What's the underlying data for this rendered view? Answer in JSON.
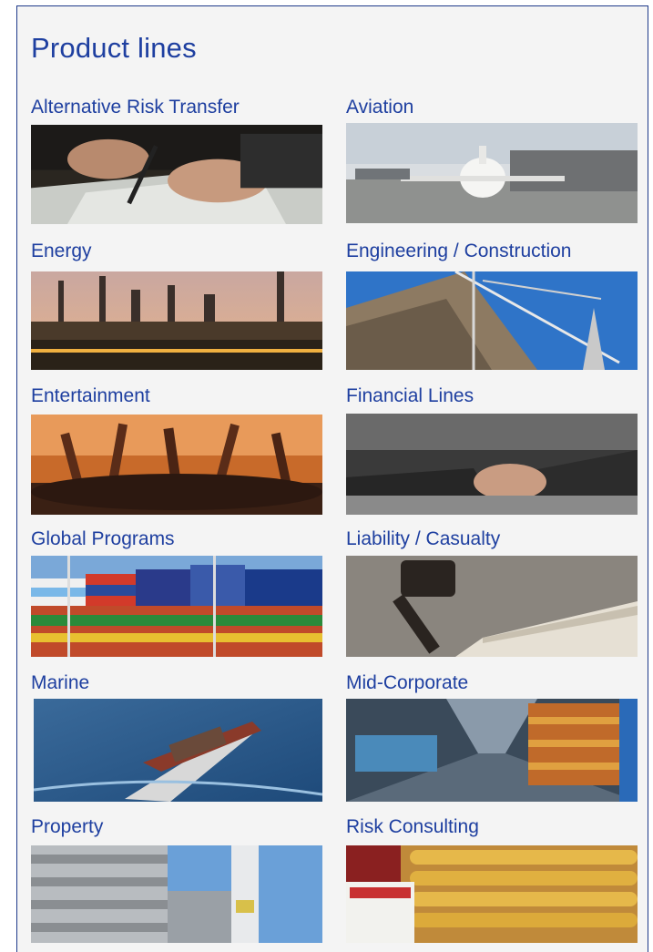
{
  "panel": {
    "title": "Product lines"
  },
  "product_lines": [
    {
      "label": "Alternative Risk Transfer",
      "image": "hands-signing-document-photo"
    },
    {
      "label": "Aviation",
      "image": "airplane-at-gate-photo"
    },
    {
      "label": "Energy",
      "image": "refinery-at-dusk-photo"
    },
    {
      "label": "Engineering / Construction",
      "image": "crane-and-building-photo"
    },
    {
      "label": "Entertainment",
      "image": "concert-crowd-photo"
    },
    {
      "label": "Financial Lines",
      "image": "handshake-photo"
    },
    {
      "label": "Global Programs",
      "image": "world-flags-photo"
    },
    {
      "label": "Liability / Casualty",
      "image": "gavel-and-book-photo"
    },
    {
      "label": "Marine",
      "image": "container-ship-photo"
    },
    {
      "label": "Mid-Corporate",
      "image": "warehouse-aisle-photo"
    },
    {
      "label": "Property",
      "image": "industrial-building-photo"
    },
    {
      "label": "Risk Consulting",
      "image": "hydrogen-cylinders-photo"
    }
  ]
}
